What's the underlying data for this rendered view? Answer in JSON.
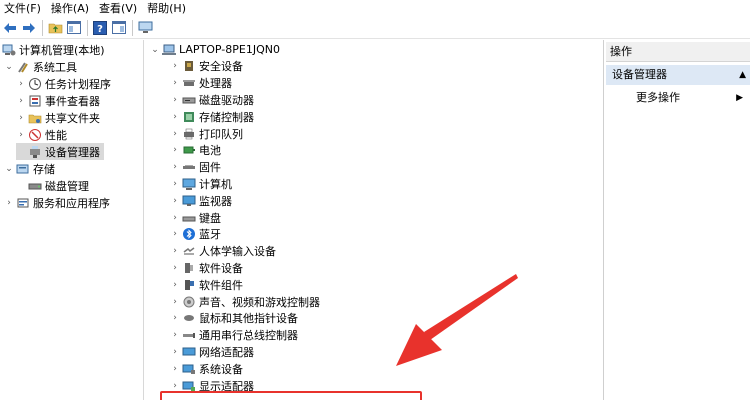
{
  "menu": [
    "文件(F)",
    "操作(A)",
    "查看(V)",
    "帮助(H)"
  ],
  "left_tree": [
    {
      "label": "计算机管理(本地)",
      "icon": "computer-management-icon",
      "level": 0,
      "expand": "",
      "selected": false
    },
    {
      "label": "系统工具",
      "icon": "tools-icon",
      "level": 1,
      "expand": "open",
      "selected": false
    },
    {
      "label": "任务计划程序",
      "icon": "clock-icon",
      "level": 2,
      "expand": "closed",
      "selected": false
    },
    {
      "label": "事件查看器",
      "icon": "event-viewer-icon",
      "level": 2,
      "expand": "closed",
      "selected": false
    },
    {
      "label": "共享文件夹",
      "icon": "shared-folder-icon",
      "level": 2,
      "expand": "closed",
      "selected": false
    },
    {
      "label": "性能",
      "icon": "performance-icon",
      "level": 2,
      "expand": "closed",
      "selected": false
    },
    {
      "label": "设备管理器",
      "icon": "device-manager-icon",
      "level": 2,
      "expand": "",
      "selected": true
    },
    {
      "label": "存储",
      "icon": "storage-icon",
      "level": 1,
      "expand": "open",
      "selected": false
    },
    {
      "label": "磁盘管理",
      "icon": "disk-management-icon",
      "level": 2,
      "expand": "",
      "selected": false
    },
    {
      "label": "服务和应用程序",
      "icon": "services-icon",
      "level": 1,
      "expand": "closed",
      "selected": false
    }
  ],
  "device_tree": {
    "root": "LAPTOP-8PE1JQN0",
    "items": [
      {
        "label": "安全设备",
        "icon": "security-device-icon"
      },
      {
        "label": "处理器",
        "icon": "processor-icon"
      },
      {
        "label": "磁盘驱动器",
        "icon": "disk-drive-icon"
      },
      {
        "label": "存储控制器",
        "icon": "storage-controller-icon"
      },
      {
        "label": "打印队列",
        "icon": "print-queue-icon"
      },
      {
        "label": "电池",
        "icon": "battery-icon"
      },
      {
        "label": "固件",
        "icon": "firmware-icon"
      },
      {
        "label": "计算机",
        "icon": "computer-icon"
      },
      {
        "label": "监视器",
        "icon": "monitor-icon"
      },
      {
        "label": "键盘",
        "icon": "keyboard-icon"
      },
      {
        "label": "蓝牙",
        "icon": "bluetooth-icon"
      },
      {
        "label": "人体学输入设备",
        "icon": "hid-icon"
      },
      {
        "label": "软件设备",
        "icon": "software-device-icon"
      },
      {
        "label": "软件组件",
        "icon": "software-component-icon"
      },
      {
        "label": "声音、视频和游戏控制器",
        "icon": "sound-icon"
      },
      {
        "label": "鼠标和其他指针设备",
        "icon": "mouse-icon"
      },
      {
        "label": "通用串行总线控制器",
        "icon": "usb-icon"
      },
      {
        "label": "网络适配器",
        "icon": "network-adapter-icon"
      },
      {
        "label": "系统设备",
        "icon": "system-device-icon"
      },
      {
        "label": "显示适配器",
        "icon": "display-adapter-icon"
      }
    ]
  },
  "actions": {
    "header": "操作",
    "section": "设备管理器",
    "more": "更多操作"
  },
  "colors": {
    "highlight": "#e8322c",
    "selection": "#d9d9d9",
    "section_bg": "#dde8f5"
  }
}
